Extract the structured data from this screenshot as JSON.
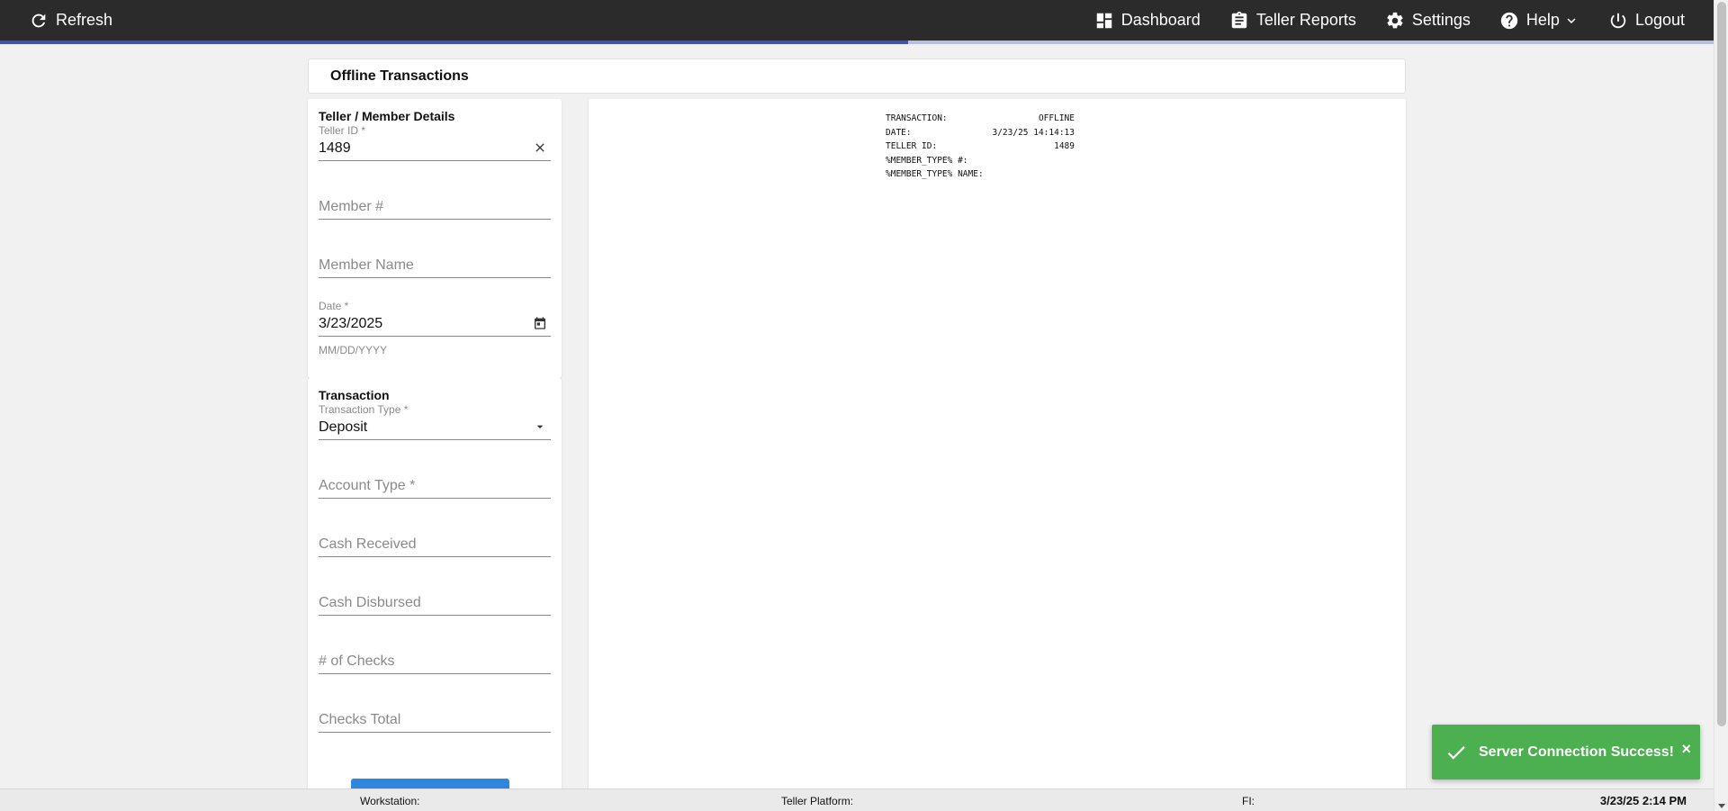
{
  "topbar": {
    "refresh_label": "Refresh",
    "dashboard_label": "Dashboard",
    "reports_label": "Teller Reports",
    "settings_label": "Settings",
    "help_label": "Help",
    "logout_label": "Logout",
    "progress_percent": 53
  },
  "page": {
    "title": "Offline Transactions"
  },
  "details": {
    "title": "Teller / Member Details",
    "teller_id": {
      "label": "Teller ID *",
      "value": "1489"
    },
    "member_number": {
      "placeholder": "Member #"
    },
    "member_name": {
      "placeholder": "Member Name"
    },
    "date": {
      "label": "Date *",
      "value": "3/23/2025",
      "hint": "MM/DD/YYYY"
    }
  },
  "transaction": {
    "title": "Transaction",
    "type": {
      "label": "Transaction Type *",
      "value": "Deposit"
    },
    "account_type": {
      "placeholder": "Account Type *"
    },
    "cash_received": {
      "placeholder": "Cash Received"
    },
    "cash_disbursed": {
      "placeholder": "Cash Disbursed"
    },
    "num_checks": {
      "placeholder": "# of Checks"
    },
    "checks_total": {
      "placeholder": "Checks Total"
    }
  },
  "receipt": {
    "lines": [
      {
        "label": "TRANSACTION:",
        "value": "OFFLINE"
      },
      {
        "label": "DATE:",
        "value": "3/23/25 14:14:13"
      },
      {
        "label": "TELLER ID:",
        "value": "1489"
      },
      {
        "label": "%MEMBER_TYPE% #:",
        "value": ""
      },
      {
        "label": "%MEMBER_TYPE% NAME:",
        "value": ""
      }
    ]
  },
  "toast": {
    "message": "Server Connection Success!",
    "close": "×"
  },
  "statusbar": {
    "workstation": "Workstation:",
    "platform": "Teller Platform:",
    "fi": "FI:",
    "datetime": "3/23/25 2:14 PM"
  },
  "colors": {
    "topbar": "#2b2b2b",
    "progress": "#3f51b5",
    "toast": "#4caf50",
    "button": "#2e86de"
  }
}
